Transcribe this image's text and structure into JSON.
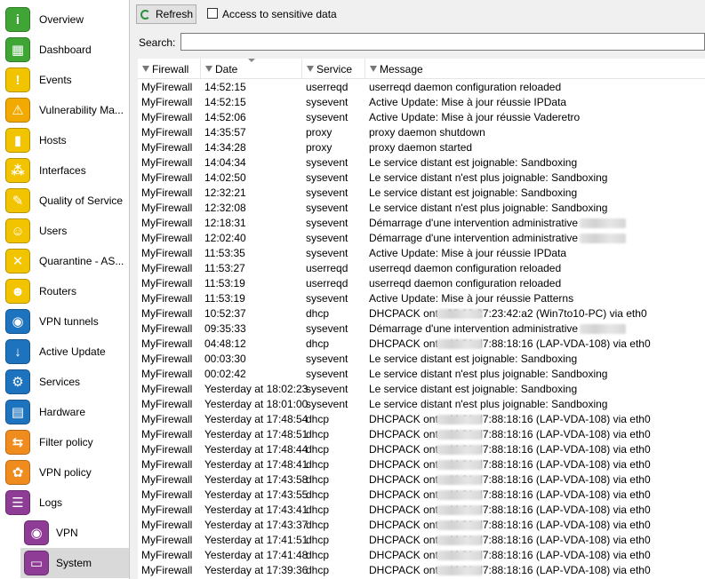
{
  "sidebar": {
    "items": [
      {
        "label": "Overview",
        "icon": "info-icon",
        "color": "#3fa535",
        "glyph": "i"
      },
      {
        "label": "Dashboard",
        "icon": "dashboard-icon",
        "color": "#3fa535",
        "glyph": "▦"
      },
      {
        "label": "Events",
        "icon": "events-icon",
        "color": "#f2c400",
        "glyph": "!"
      },
      {
        "label": "Vulnerability Ma...",
        "icon": "vulnerability-icon",
        "color": "#f2a900",
        "glyph": "⚠"
      },
      {
        "label": "Hosts",
        "icon": "hosts-icon",
        "color": "#f2c400",
        "glyph": "▮"
      },
      {
        "label": "Interfaces",
        "icon": "interfaces-icon",
        "color": "#f2c400",
        "glyph": "⁂"
      },
      {
        "label": "Quality of Service",
        "icon": "qos-icon",
        "color": "#f2c400",
        "glyph": "✎"
      },
      {
        "label": "Users",
        "icon": "users-icon",
        "color": "#f2c400",
        "glyph": "☺"
      },
      {
        "label": "Quarantine - AS...",
        "icon": "quarantine-icon",
        "color": "#f2c400",
        "glyph": "✕"
      },
      {
        "label": "Routers",
        "icon": "routers-icon",
        "color": "#f2c400",
        "glyph": "☻"
      },
      {
        "label": "VPN tunnels",
        "icon": "vpn-tunnels-icon",
        "color": "#1e73be",
        "glyph": "◉"
      },
      {
        "label": "Active Update",
        "icon": "active-update-icon",
        "color": "#1e73be",
        "glyph": "↓"
      },
      {
        "label": "Services",
        "icon": "services-icon",
        "color": "#1e73be",
        "glyph": "⚙"
      },
      {
        "label": "Hardware",
        "icon": "hardware-icon",
        "color": "#1e73be",
        "glyph": "▤"
      },
      {
        "label": "Filter policy",
        "icon": "filter-policy-icon",
        "color": "#f08c1e",
        "glyph": "⇆"
      },
      {
        "label": "VPN policy",
        "icon": "vpn-policy-icon",
        "color": "#f08c1e",
        "glyph": "✿"
      },
      {
        "label": "Logs",
        "icon": "logs-icon",
        "color": "#8e3c96",
        "glyph": "☰"
      }
    ],
    "subitems": [
      {
        "label": "VPN",
        "icon": "vpn-log-icon",
        "color": "#8e3c96",
        "glyph": "◉"
      },
      {
        "label": "System",
        "icon": "system-log-icon",
        "color": "#8e3c96",
        "glyph": "▭"
      }
    ]
  },
  "toolbar": {
    "refresh_label": "Refresh",
    "sensitive_label": "Access to sensitive data"
  },
  "search": {
    "label": "Search:",
    "value": ""
  },
  "table": {
    "columns": [
      "Firewall",
      "Date",
      "Service",
      "Message"
    ],
    "rows": [
      [
        "MyFirewall",
        "14:52:15",
        "userreqd",
        "userreqd daemon configuration reloaded",
        ""
      ],
      [
        "MyFirewall",
        "14:52:15",
        "sysevent",
        "Active Update: Mise à  jour réussie IPData",
        ""
      ],
      [
        "MyFirewall",
        "14:52:06",
        "sysevent",
        "Active Update: Mise à  jour réussie Vaderetro",
        ""
      ],
      [
        "MyFirewall",
        "14:35:57",
        "proxy",
        "proxy daemon shutdown",
        ""
      ],
      [
        "MyFirewall",
        "14:34:28",
        "proxy",
        "proxy daemon started",
        ""
      ],
      [
        "MyFirewall",
        "14:04:34",
        "sysevent",
        "Le service distant est joignable: Sandboxing",
        ""
      ],
      [
        "MyFirewall",
        "14:02:50",
        "sysevent",
        "Le service distant n'est plus joignable: Sandboxing",
        ""
      ],
      [
        "MyFirewall",
        "12:32:21",
        "sysevent",
        "Le service distant est joignable: Sandboxing",
        ""
      ],
      [
        "MyFirewall",
        "12:32:08",
        "sysevent",
        "Le service distant n'est plus joignable: Sandboxing",
        ""
      ],
      [
        "MyFirewall",
        "12:18:31",
        "sysevent",
        "Démarrage d'une intervention administrative",
        "blur"
      ],
      [
        "MyFirewall",
        "12:02:40",
        "sysevent",
        "Démarrage d'une intervention administrative",
        "blur"
      ],
      [
        "MyFirewall",
        "11:53:35",
        "sysevent",
        "Active Update: Mise à  jour réussie IPData",
        ""
      ],
      [
        "MyFirewall",
        "11:53:27",
        "userreqd",
        "userreqd daemon configuration reloaded",
        ""
      ],
      [
        "MyFirewall",
        "11:53:19",
        "userreqd",
        "userreqd daemon configuration reloaded",
        ""
      ],
      [
        "MyFirewall",
        "11:53:19",
        "sysevent",
        "Active Update: Mise à  jour réussie Patterns",
        ""
      ],
      [
        "MyFirewall",
        "10:52:37",
        "dhcp",
        "DHCPACK on",
        "to 08:00:27:23:42:a2 (Win7to10-PC) via eth0"
      ],
      [
        "MyFirewall",
        "09:35:33",
        "sysevent",
        "Démarrage d'une intervention administrative",
        "blur"
      ],
      [
        "MyFirewall",
        "04:48:12",
        "dhcp",
        "DHCPACK on",
        "to d4:81:d7:88:18:16 (LAP-VDA-108) via eth0"
      ],
      [
        "MyFirewall",
        "00:03:30",
        "sysevent",
        "Le service distant est joignable: Sandboxing",
        ""
      ],
      [
        "MyFirewall",
        "00:02:42",
        "sysevent",
        "Le service distant n'est plus joignable: Sandboxing",
        ""
      ],
      [
        "MyFirewall",
        "Yesterday at 18:02:23",
        "sysevent",
        "Le service distant est joignable: Sandboxing",
        ""
      ],
      [
        "MyFirewall",
        "Yesterday at 18:01:00",
        "sysevent",
        "Le service distant n'est plus joignable: Sandboxing",
        ""
      ],
      [
        "MyFirewall",
        "Yesterday at 17:48:54",
        "dhcp",
        "DHCPACK on",
        "to d4:81:d7:88:18:16 (LAP-VDA-108) via eth0"
      ],
      [
        "MyFirewall",
        "Yesterday at 17:48:51",
        "dhcp",
        "DHCPACK on",
        "to d4:81:d7:88:18:16 (LAP-VDA-108) via eth0"
      ],
      [
        "MyFirewall",
        "Yesterday at 17:48:44",
        "dhcp",
        "DHCPACK on",
        "to d4:81:d7:88:18:16 (LAP-VDA-108) via eth0"
      ],
      [
        "MyFirewall",
        "Yesterday at 17:48:41",
        "dhcp",
        "DHCPACK on",
        "to d4:81:d7:88:18:16 (LAP-VDA-108) via eth0"
      ],
      [
        "MyFirewall",
        "Yesterday at 17:43:58",
        "dhcp",
        "DHCPACK on",
        "to d4:81:d7:88:18:16 (LAP-VDA-108) via eth0"
      ],
      [
        "MyFirewall",
        "Yesterday at 17:43:55",
        "dhcp",
        "DHCPACK on",
        "to d4:81:d7:88:18:16 (LAP-VDA-108) via eth0"
      ],
      [
        "MyFirewall",
        "Yesterday at 17:43:41",
        "dhcp",
        "DHCPACK on",
        "to d4:81:d7:88:18:16 (LAP-VDA-108) via eth0"
      ],
      [
        "MyFirewall",
        "Yesterday at 17:43:37",
        "dhcp",
        "DHCPACK on",
        "to d4:81:d7:88:18:16 (LAP-VDA-108) via eth0"
      ],
      [
        "MyFirewall",
        "Yesterday at 17:41:51",
        "dhcp",
        "DHCPACK on",
        "to d4:81:d7:88:18:16 (LAP-VDA-108) via eth0"
      ],
      [
        "MyFirewall",
        "Yesterday at 17:41:48",
        "dhcp",
        "DHCPACK on",
        "to d4:81:d7:88:18:16 (LAP-VDA-108) via eth0"
      ],
      [
        "MyFirewall",
        "Yesterday at 17:39:36",
        "dhcp",
        "DHCPACK on",
        "to d4:81:d7:88:18:16 (LAP-VDA-108) via eth0"
      ]
    ]
  }
}
